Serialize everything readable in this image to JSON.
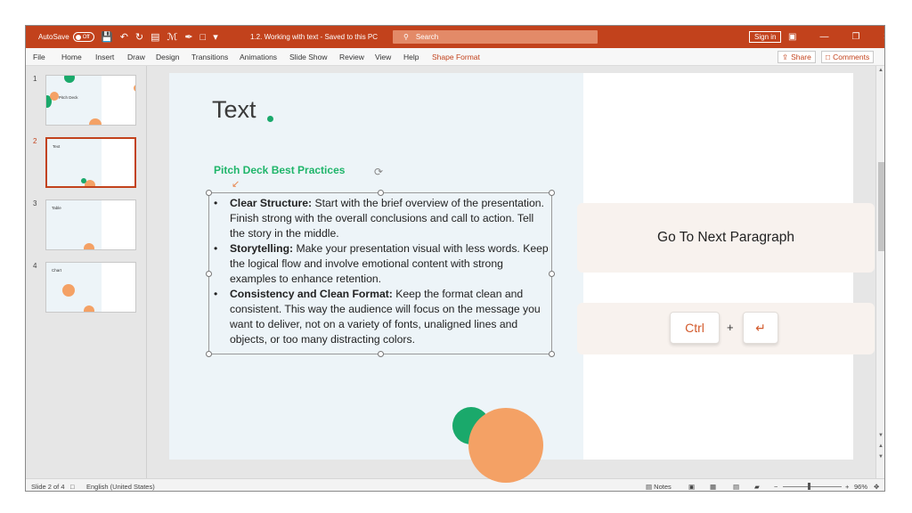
{
  "titlebar": {
    "autosave_label": "AutoSave",
    "autosave_state": "Off",
    "document_title": "1.2. Working with text - Saved to this PC",
    "search_placeholder": "Search",
    "signin_label": "Sign in"
  },
  "ribbon": {
    "tabs": [
      "File",
      "Home",
      "Insert",
      "Draw",
      "Design",
      "Transitions",
      "Animations",
      "Slide Show",
      "Review",
      "View",
      "Help",
      "Shape Format"
    ],
    "active_tab": "Shape Format",
    "share_label": "Share",
    "comments_label": "Comments"
  },
  "thumbnails": [
    {
      "number": "1",
      "title": "Pitch Deck"
    },
    {
      "number": "2",
      "title": "Text"
    },
    {
      "number": "3",
      "title": "Table"
    },
    {
      "number": "4",
      "title": "Chart"
    }
  ],
  "slide": {
    "title": "Text",
    "subheading": "Pitch Deck Best Practices",
    "bullets": [
      {
        "bold": "Clear Structure:",
        "text": " Start with the brief overview of the presentation. Finish strong with the overall conclusions and call to action. Tell the story in the middle."
      },
      {
        "bold": "Storytelling:",
        "text": " Make your presentation visual with less words. Keep the logical flow and involve emotional content with strong examples to enhance retention."
      },
      {
        "bold": "Consistency and Clean Format:",
        "text": " Keep the format clean and consistent. This way the audience will focus on the message you want to deliver, not on a variety of fonts, unaligned lines and objects, or too many distracting colors."
      }
    ],
    "shortcut_caption": "Go To Next Paragraph",
    "shortcut_key": "Ctrl",
    "shortcut_plus": "+"
  },
  "statusbar": {
    "slide_info": "Slide 2 of 4",
    "language": "English (United States)",
    "notes_label": "Notes",
    "zoom": "96%"
  },
  "colors": {
    "accent": "#c2421c",
    "green": "#1aa96b",
    "orange": "#f4a165"
  }
}
